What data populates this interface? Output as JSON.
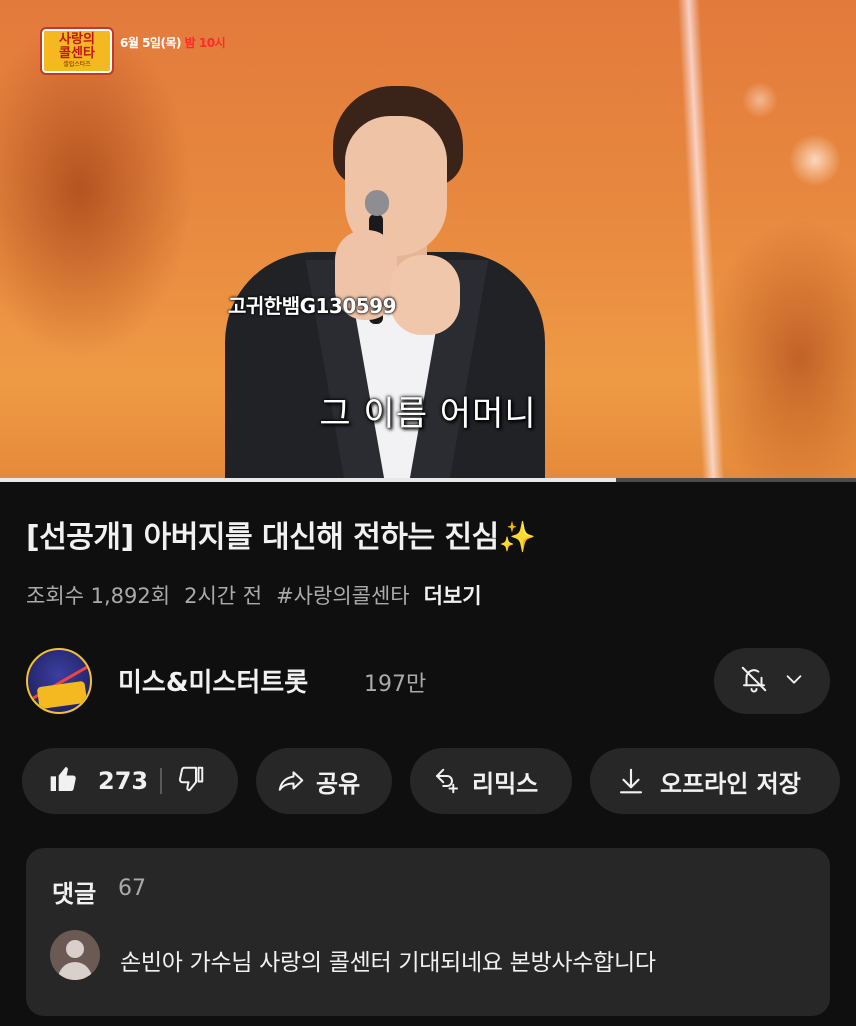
{
  "video": {
    "show_logo_line1": "사랑의",
    "show_logo_line2": "콜센타",
    "show_logo_sub": "셀럽스타즈",
    "air_date": "6월 5일(목) ",
    "air_time": "밤 10시",
    "watermark": "고귀한뱀G130599",
    "subtitle": "그 이름 어머니",
    "progress_fraction": 0.72
  },
  "info": {
    "title": "[선공개] 아버지를 대신해 전하는 진심✨",
    "views": "조회수 1,892회",
    "time_ago": "2시간 전",
    "hashtag": "#사랑의콜센타",
    "more_label": "더보기"
  },
  "channel": {
    "name": "미스&미스터트롯",
    "subscribers": "197만",
    "bell_icon": "bell-off-icon",
    "dropdown_icon": "chevron-down-icon"
  },
  "actions": {
    "like_count": "273",
    "share_label": "공유",
    "remix_label": "리믹스",
    "offline_label": "오프라인 저장"
  },
  "comments": {
    "header": "댓글",
    "count": "67",
    "first_comment": "손빈아 가수님 사랑의 콜센터 기대되네요 본방사수합니다"
  },
  "colors": {
    "background": "#0f0f0f",
    "surface": "#272727",
    "text_primary": "#f1f1f1",
    "text_secondary": "#aaaaaa"
  }
}
